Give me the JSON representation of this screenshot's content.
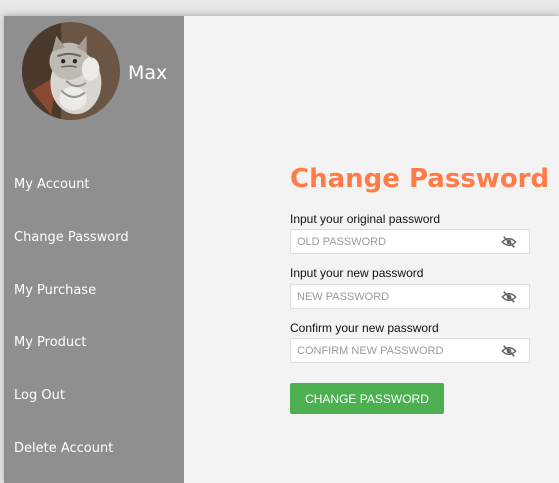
{
  "user": {
    "name": "Max"
  },
  "sidebar": {
    "items": [
      {
        "label": "My Account"
      },
      {
        "label": "Change Password"
      },
      {
        "label": "My Purchase"
      },
      {
        "label": "My Product"
      },
      {
        "label": "Log Out"
      },
      {
        "label": "Delete Account"
      }
    ]
  },
  "form": {
    "title": "Change Password",
    "fields": [
      {
        "label": "Input your original password",
        "placeholder": "OLD PASSWORD",
        "value": ""
      },
      {
        "label": "Input your new password",
        "placeholder": "NEW PASSWORD",
        "value": ""
      },
      {
        "label": "Confirm your new password",
        "placeholder": "CONFIRM NEW PASSWORD",
        "value": ""
      }
    ],
    "submit_label": "CHANGE PASSWORD"
  },
  "icons": {
    "visibility": "eye-slash-icon",
    "avatar": "cat-photo"
  },
  "colors": {
    "sidebar_bg": "#8f8f8f",
    "title": "#ff7b47",
    "button": "#4caf50",
    "page_bg": "#f3f3f3"
  }
}
